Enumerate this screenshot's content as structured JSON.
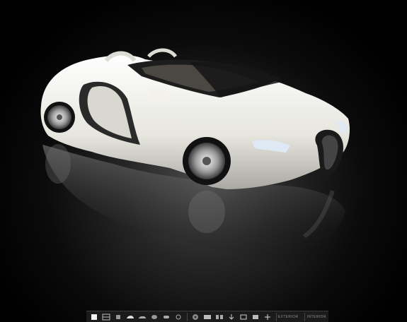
{
  "viewer": {
    "toolbar": {
      "tools": [
        {
          "name": "white-square-icon"
        },
        {
          "name": "split-view-icon"
        },
        {
          "name": "seat-icon"
        },
        {
          "name": "car-front-icon"
        },
        {
          "name": "car-side-icon"
        },
        {
          "name": "car-top-icon"
        },
        {
          "name": "car-rear-icon"
        },
        {
          "name": "car-interior-icon"
        },
        {
          "name": "wheel-icon"
        },
        {
          "name": "gallery-icon"
        },
        {
          "name": "gallery-grid-icon"
        },
        {
          "name": "download-icon"
        },
        {
          "name": "fullscreen-icon"
        },
        {
          "name": "frame-icon"
        },
        {
          "name": "zoom-icon"
        }
      ],
      "exterior_label": "EXTERIOR",
      "interior_label": "INTERIOR"
    },
    "colors": {
      "background": "#000000",
      "car_body": "#ecebe4",
      "toolbar": "#1b1b1b"
    }
  }
}
